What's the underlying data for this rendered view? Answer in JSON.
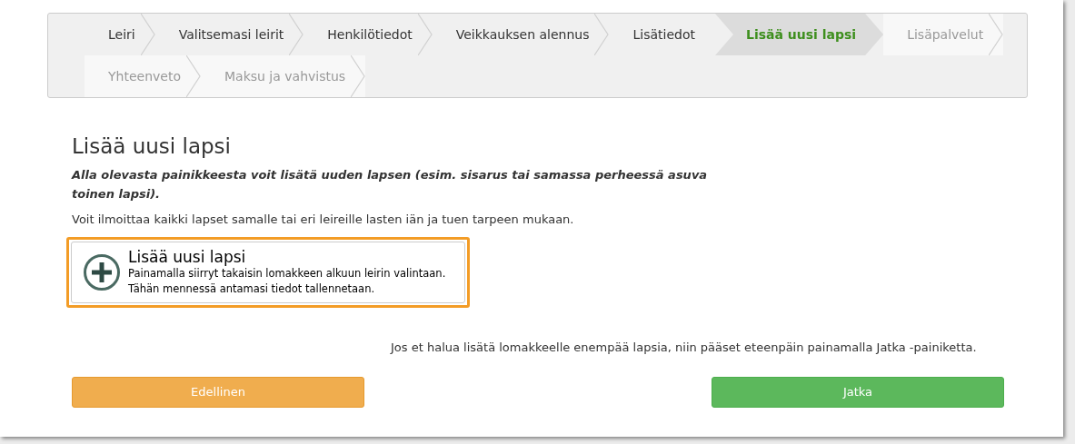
{
  "steps": {
    "rows": [
      [
        {
          "label": "Leiri",
          "kind": "done"
        },
        {
          "label": "Valitsemasi leirit",
          "kind": "done"
        },
        {
          "label": "Henkilötiedot",
          "kind": "done"
        },
        {
          "label": "Veikkauksen alennus",
          "kind": "done"
        },
        {
          "label": "Lisätiedot",
          "kind": "done"
        },
        {
          "label": "Lisää uusi lapsi",
          "kind": "current"
        },
        {
          "label": "Lisäpalvelut",
          "kind": "todo"
        }
      ],
      [
        {
          "label": "Yhteenveto",
          "kind": "todo"
        },
        {
          "label": "Maksu ja vahvistus",
          "kind": "todo"
        }
      ]
    ]
  },
  "heading": "Lisää uusi lapsi",
  "intro": "Alla olevasta painikkeesta voit lisätä uuden lapsen (esim. sisarus tai samassa perheessä asuva toinen lapsi).",
  "note": "Voit ilmoittaa kaikki lapset samalle tai eri leireille lasten iän ja tuen tarpeen mukaan.",
  "add_button": {
    "title": "Lisää uusi lapsi",
    "lines": [
      "Painamalla siirryt takaisin lomakkeen alkuun leirin valintaan.",
      "Tähän mennessä antamasi tiedot tallennetaan."
    ],
    "focused": true
  },
  "continue_hint": "Jos et halua lisätä lomakkeelle enempää lapsia, niin pääset eteenpäin painamalla Jatka -painiketta.",
  "buttons": [
    {
      "label": "Edellinen",
      "kind": "previous"
    },
    {
      "label": "Jatka",
      "kind": "next"
    }
  ]
}
